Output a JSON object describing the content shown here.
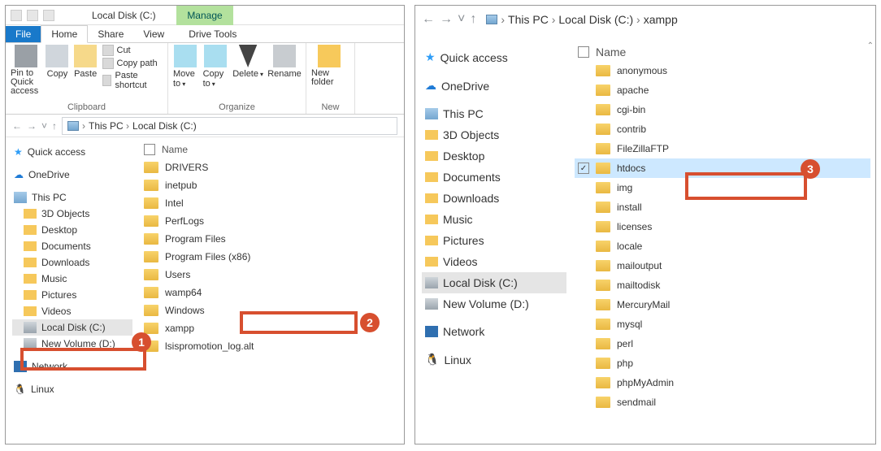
{
  "left": {
    "title": "Local Disk (C:)",
    "manage": "Manage",
    "tabs": {
      "file": "File",
      "home": "Home",
      "share": "Share",
      "view": "View",
      "drive": "Drive Tools"
    },
    "ribbon": {
      "clipboard": {
        "label": "Clipboard",
        "pin": "Pin to Quick access",
        "copy": "Copy",
        "paste": "Paste",
        "cut": "Cut",
        "copypath": "Copy path",
        "pasteshort": "Paste shortcut"
      },
      "organize": {
        "label": "Organize",
        "moveto": "Move to",
        "copyto": "Copy to",
        "delete": "Delete",
        "rename": "Rename"
      },
      "newgrp": {
        "label": "New",
        "newfolder": "New folder"
      }
    },
    "breadcrumb": [
      "This PC",
      "Local Disk (C:)"
    ],
    "nav": {
      "quick": "Quick access",
      "onedrive": "OneDrive",
      "thispc": "This PC",
      "sub": [
        "3D Objects",
        "Desktop",
        "Documents",
        "Downloads",
        "Music",
        "Pictures",
        "Videos",
        "Local Disk (C:)",
        "New Volume (D:)"
      ],
      "network": "Network",
      "linux": "Linux"
    },
    "list": {
      "header": "Name",
      "items": [
        "DRIVERS",
        "inetpub",
        "Intel",
        "PerfLogs",
        "Program Files",
        "Program Files (x86)",
        "Users",
        "wamp64",
        "Windows",
        "xampp",
        "lsispromotion_log.alt"
      ]
    }
  },
  "right": {
    "breadcrumb": [
      "This PC",
      "Local Disk (C:)",
      "xampp"
    ],
    "nav": {
      "quick": "Quick access",
      "onedrive": "OneDrive",
      "thispc": "This PC",
      "sub": [
        "3D Objects",
        "Desktop",
        "Documents",
        "Downloads",
        "Music",
        "Pictures",
        "Videos",
        "Local Disk (C:)",
        "New Volume (D:)"
      ],
      "network": "Network",
      "linux": "Linux"
    },
    "list": {
      "header": "Name",
      "items": [
        "anonymous",
        "apache",
        "cgi-bin",
        "contrib",
        "FileZillaFTP",
        "htdocs",
        "img",
        "install",
        "licenses",
        "locale",
        "mailoutput",
        "mailtodisk",
        "MercuryMail",
        "mysql",
        "perl",
        "php",
        "phpMyAdmin",
        "sendmail"
      ],
      "selected": "htdocs"
    }
  },
  "annotations": {
    "a1": "1",
    "a2": "2",
    "a3": "3"
  }
}
